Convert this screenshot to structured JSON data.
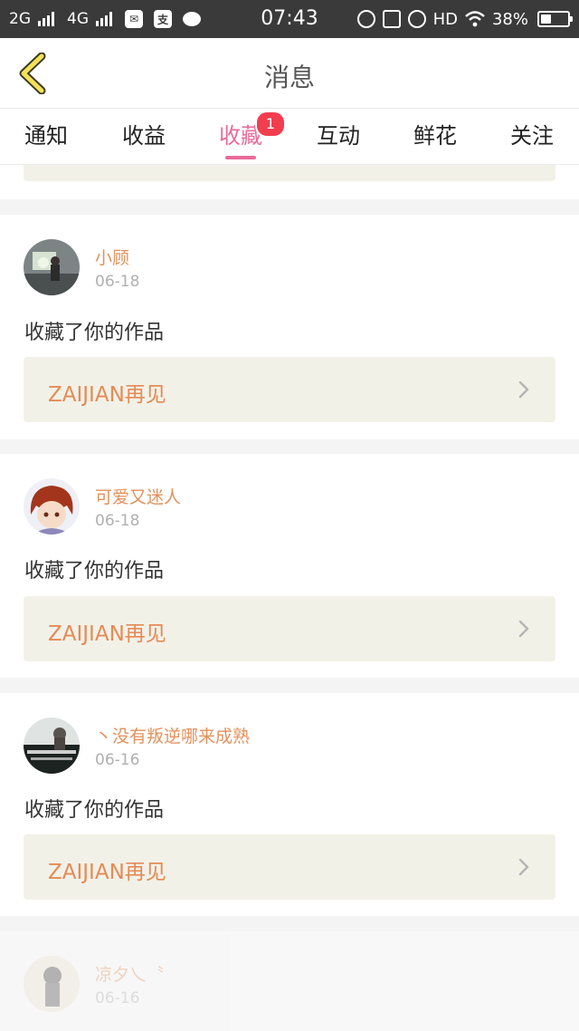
{
  "status_bar": {
    "net1": "2G",
    "net2": "4G",
    "app_icon_text": "支",
    "time": "07:43",
    "hd": "HD",
    "battery_percent": "38%",
    "battery_level": 0.38
  },
  "header": {
    "title": "消息"
  },
  "tabs": [
    {
      "label": "通知"
    },
    {
      "label": "收益"
    },
    {
      "label": "收藏",
      "active": true,
      "badge": "1"
    },
    {
      "label": "互动"
    },
    {
      "label": "鲜花"
    },
    {
      "label": "关注"
    }
  ],
  "messages": [
    {
      "user": "小顾",
      "date": "06-18",
      "action": "收藏了你的作品",
      "work": "ZAIJIAN再见"
    },
    {
      "user": "可爱又迷人",
      "date": "06-18",
      "action": "收藏了你的作品",
      "work": "ZAIJIAN再见"
    },
    {
      "user": "丶没有叛逆哪来成熟",
      "date": "06-16",
      "action": "收藏了你的作品",
      "work": "ZAIJIAN再见"
    },
    {
      "user": "凉夕乀〝",
      "date": "06-16"
    }
  ],
  "colors": {
    "accent_pink": "#e86a9a",
    "badge_red": "#f23d4f",
    "username_orange": "#e3915c",
    "work_title_orange": "#e58b55",
    "work_card_bg": "#f2f1e8"
  },
  "icons": {
    "back": "chevron-left-icon",
    "item_arrow": "chevron-right-icon"
  }
}
